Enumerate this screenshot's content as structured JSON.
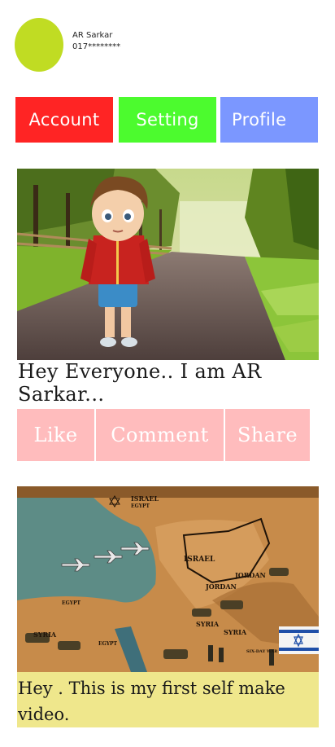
{
  "user": {
    "name": "AR Sarkar",
    "phone": "017********"
  },
  "tabs": [
    {
      "label": "Account",
      "color": "#ff2424"
    },
    {
      "label": "Setting",
      "color": "#4cfb2e"
    },
    {
      "label": "Profile",
      "color": "#7b97ff"
    }
  ],
  "posts": [
    {
      "image": "cartoon-boy-on-road",
      "caption": "Hey Everyone.. I am AR Sarkar...",
      "actions": [
        "Like",
        "Comment",
        "Share"
      ]
    },
    {
      "image": "middle-east-war-map",
      "map_labels": [
        "ISRAEL",
        "EGYPT",
        "ISRAEL",
        "JORDAN",
        "JORDAN",
        "SYRIA",
        "SYRIA",
        "SYRIA",
        "EGYPT",
        "EGYPT",
        "SIX-DAY WAR"
      ],
      "caption": "Hey . This is my first self make video."
    }
  ],
  "colors": {
    "avatar": "#c0dc23",
    "action_button": "#ffbcbd",
    "caption_bg": "#efe78c"
  }
}
